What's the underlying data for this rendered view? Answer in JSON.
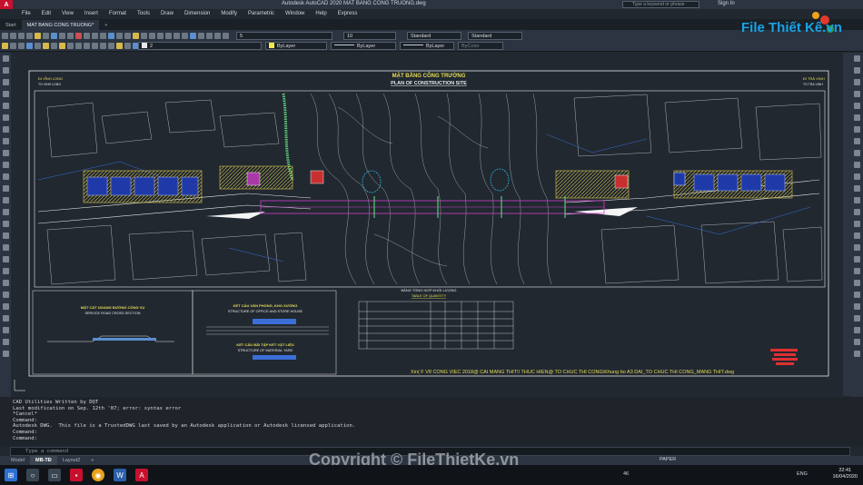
{
  "window": {
    "app_logo": "A",
    "title": "Autodesk AutoCAD 2020    MAT BANG CONG TRUONG.dwg",
    "search_placeholder": "Type a keyword or phrase",
    "sign_in": "Sign In"
  },
  "menu": [
    "File",
    "Edit",
    "View",
    "Insert",
    "Format",
    "Tools",
    "Draw",
    "Dimension",
    "Modify",
    "Parametric",
    "Window",
    "Help",
    "Express"
  ],
  "tabs": [
    {
      "label": "Start",
      "active": false
    },
    {
      "label": "MAT BANG CONG TRUONG*",
      "active": true
    },
    {
      "label": "+",
      "active": false
    }
  ],
  "toolbar": {
    "layer_value": "2",
    "color_value": "ByLayer",
    "linetype_value": "ByLayer",
    "lineweight_value": "ByLayer",
    "plotstyle_value": "ByColor",
    "dim_scale": "5",
    "text_height": "10",
    "text_style": "Standard",
    "dim_style": "Standard",
    "colors": {
      "bylayer": "#f2e84a",
      "layer": "#e8e8e8"
    }
  },
  "drawing": {
    "title_vn": "MẶT BẰNG CÔNG TRƯỜNG",
    "title_en": "PLAN OF CONSTRUCTION SITE",
    "left_direction": "ĐI VĨNH LONG",
    "left_direction_sub": "TO VINH LONG",
    "right_direction": "ĐI TRÀ VINH",
    "right_direction_sub": "TO TRA VINH",
    "table_title_vn": "BẢNG TỔNG HỢP KHỐI LƯỢNG",
    "table_title_en": "TABLE OF QUANTITY",
    "section1_vn": "MẶT CẮT NGANG ĐƯỜNG CÔNG VỤ",
    "section1_en": "SERVICE ROAD CROSS SECTION",
    "section2_vn": "KẾT CẤU VĂN PHÒNG, KHO XƯỞNG",
    "section2_en": "STRUCTURE OF OFFICE AND STORE HOUSE",
    "section3_vn": "KẾT CẤU BÃI TẬP KẾT VẬT LIỆU",
    "section3_en": "STRUCTURE OF MATERIAL YARD",
    "footer_note": "Xin( F V8 CONG VIEC 2018@ CAI MANG THIT\\! THUC HIEN@ TO CHUC THI CONG\\Khung bo A3 DAI_TO CHUC THI CONG_MANG THIT.dwg"
  },
  "command_history": [
    "CAD Utilities Written by DQT",
    "Last modification on Sep. 12th '07; error: syntax error",
    "*Cancel*",
    "Command:",
    "Autodesk DWG.  This file is a TrustedDWG last saved by an Autodesk application or Autodesk licensed application.",
    "Command:",
    "Command:"
  ],
  "command_placeholder": "Type a command",
  "layout_tabs": [
    {
      "label": "Model",
      "active": false
    },
    {
      "label": "MB-TĐ",
      "active": true
    },
    {
      "label": "Layout2",
      "active": false
    },
    {
      "label": "+",
      "active": false
    }
  ],
  "status": {
    "paper": "PAPER"
  },
  "taskbar": {
    "tray_num": "46",
    "lang": "ENG",
    "time": "22:41",
    "date": "16/04/2020"
  },
  "branding": {
    "logo_text": "File Thiết Kế.vn",
    "watermark": "Copyright © FileThietKe.vn"
  }
}
